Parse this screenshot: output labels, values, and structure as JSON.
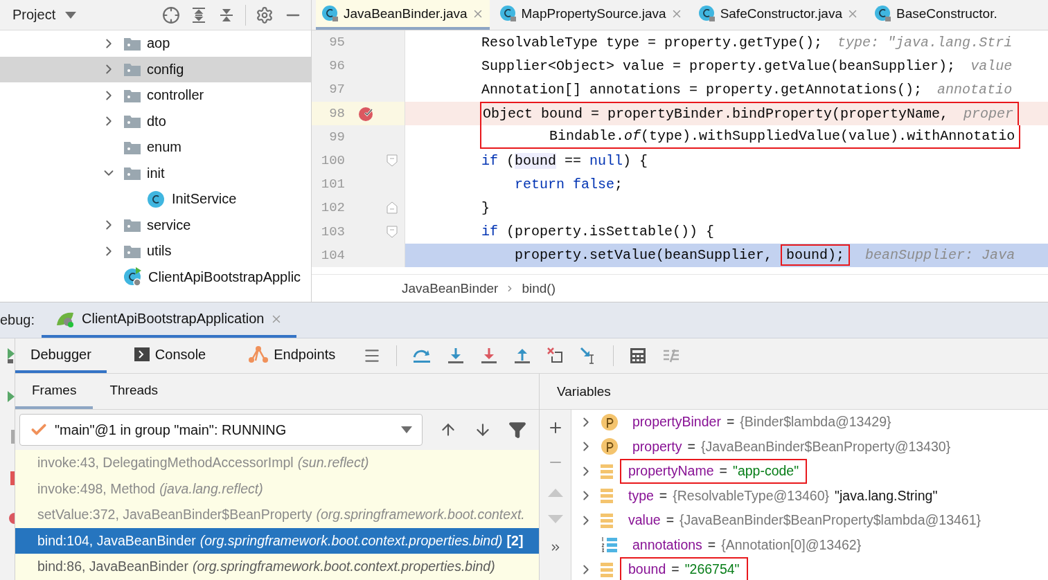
{
  "project_panel": {
    "title": "Project",
    "tree": [
      {
        "kind": "folder",
        "label": "aop",
        "expanded": false,
        "selected": false
      },
      {
        "kind": "folder",
        "label": "config",
        "expanded": false,
        "selected": true
      },
      {
        "kind": "folder",
        "label": "controller",
        "expanded": false,
        "selected": false
      },
      {
        "kind": "folder",
        "label": "dto",
        "expanded": false,
        "selected": false
      },
      {
        "kind": "leaf-folder",
        "label": "enum",
        "selected": false
      },
      {
        "kind": "folder",
        "label": "init",
        "expanded": true,
        "selected": false,
        "children": [
          {
            "kind": "class",
            "label": "InitService",
            "selected": false
          }
        ]
      },
      {
        "kind": "folder",
        "label": "service",
        "expanded": false,
        "selected": false
      },
      {
        "kind": "folder",
        "label": "utils",
        "expanded": false,
        "selected": false
      },
      {
        "kind": "app",
        "label": "ClientApiBootstrapApplic",
        "selected": false
      }
    ]
  },
  "editor": {
    "tabs": [
      {
        "label": "JavaBeanBinder.java",
        "selected": true,
        "closable": true
      },
      {
        "label": "MapPropertySource.java",
        "selected": false,
        "closable": true
      },
      {
        "label": "SafeConstructor.java",
        "selected": false,
        "closable": true
      },
      {
        "label": "BaseConstructor.",
        "selected": false,
        "closable": false
      }
    ],
    "lines": [
      {
        "number": "95",
        "breakpoint": false,
        "current": false,
        "boxed": false,
        "tokens": [
          {
            "kind": "plain",
            "text": "ResolvableType type = property.getType();"
          },
          {
            "kind": "hint",
            "text": "type: \"java.lang.Stri"
          }
        ]
      },
      {
        "number": "96",
        "breakpoint": false,
        "current": false,
        "boxed": false,
        "tokens": [
          {
            "kind": "plain",
            "text": "Supplier<Object> value = property.getValue(beanSupplier);"
          },
          {
            "kind": "hint",
            "text": "value"
          }
        ]
      },
      {
        "number": "97",
        "breakpoint": false,
        "current": false,
        "boxed": false,
        "tokens": [
          {
            "kind": "plain",
            "text": "Annotation[] annotations = property.getAnnotations();"
          },
          {
            "kind": "hint",
            "text": "annotatio"
          }
        ]
      },
      {
        "number": "98",
        "breakpoint": true,
        "current": false,
        "boxed": true,
        "tokens": [
          {
            "kind": "plain",
            "text": "Object bound = propertyBinder.bindProperty(propertyName,"
          },
          {
            "kind": "hint",
            "text": "proper"
          }
        ]
      },
      {
        "number": "99",
        "breakpoint": false,
        "current": false,
        "boxed": true,
        "tokens": [
          {
            "kind": "plain",
            "text": "        Bindable."
          },
          {
            "kind": "italic",
            "text": "of"
          },
          {
            "kind": "plain",
            "text": "(type).withSuppliedValue(value).withAnnotatio"
          }
        ]
      },
      {
        "number": "100",
        "breakpoint": false,
        "current": false,
        "boxed": false,
        "fold_open": true,
        "tokens": [
          {
            "kind": "keyword",
            "text": "if"
          },
          {
            "kind": "plain",
            "text": " ("
          },
          {
            "kind": "usage",
            "text": "bound"
          },
          {
            "kind": "plain",
            "text": " == "
          },
          {
            "kind": "keyword",
            "text": "null"
          },
          {
            "kind": "plain",
            "text": ") {"
          }
        ]
      },
      {
        "number": "101",
        "breakpoint": false,
        "current": false,
        "boxed": false,
        "tokens": [
          {
            "kind": "keyword",
            "text": "    return false"
          },
          {
            "kind": "plain",
            "text": ";"
          }
        ]
      },
      {
        "number": "102",
        "breakpoint": false,
        "current": false,
        "boxed": false,
        "fold_close": true,
        "tokens": [
          {
            "kind": "plain",
            "text": "}"
          }
        ]
      },
      {
        "number": "103",
        "breakpoint": false,
        "current": false,
        "boxed": false,
        "fold_open": true,
        "tokens": [
          {
            "kind": "keyword",
            "text": "if"
          },
          {
            "kind": "plain",
            "text": " (property.isSettable()) {"
          }
        ]
      },
      {
        "number": "104",
        "breakpoint": false,
        "current": true,
        "boxed": false,
        "tokens": [
          {
            "kind": "plain",
            "text": "    property.setValue(beanSupplier, "
          },
          {
            "kind": "boxed",
            "text": "bound);"
          },
          {
            "kind": "hint",
            "text": "beanSupplier: Java"
          }
        ]
      }
    ],
    "breadcrumb": [
      "JavaBeanBinder",
      "bind()"
    ]
  },
  "debug": {
    "label": "ebug:",
    "session_tab": {
      "label": "ClientApiBootstrapApplication",
      "selected": true
    },
    "tabs": [
      {
        "label": "Debugger",
        "selected": true
      },
      {
        "label": "Console",
        "selected": false
      },
      {
        "label": "Endpoints",
        "selected": false
      }
    ],
    "frames_panel": {
      "tabs": [
        {
          "label": "Frames",
          "selected": true
        },
        {
          "label": "Threads",
          "selected": false
        }
      ],
      "thread": "\"main\"@1 in group \"main\": RUNNING",
      "frames": [
        {
          "method": "invoke:43, DelegatingMethodAccessorImpl",
          "package": "(sun.reflect)",
          "library": true,
          "selected": false
        },
        {
          "method": "invoke:498, Method",
          "package": "(java.lang.reflect)",
          "library": true,
          "selected": false
        },
        {
          "method": "setValue:372, JavaBeanBinder$BeanProperty",
          "package": "(org.springframework.boot.context.",
          "library": true,
          "selected": false
        },
        {
          "method": "bind:104, JavaBeanBinder",
          "package": "(org.springframework.boot.context.properties.bind)",
          "badge": "[2]",
          "library": false,
          "selected": true
        },
        {
          "method": "bind:86, JavaBeanBinder",
          "package": "(org.springframework.boot.context.properties.bind)",
          "library": false,
          "selected": false
        }
      ]
    },
    "variables_panel": {
      "title": "Variables",
      "variables": [
        {
          "kind": "param",
          "name": "propertyBinder",
          "separator": "=",
          "value": "{Binder$lambda@13429}",
          "is_string": false,
          "expandable": true,
          "boxed": false
        },
        {
          "kind": "param",
          "name": "property",
          "separator": "=",
          "value": "{JavaBeanBinder$BeanProperty@13430}",
          "is_string": false,
          "expandable": true,
          "boxed": false
        },
        {
          "kind": "field",
          "name": "propertyName",
          "separator": "=",
          "value": "\"app-code\"",
          "is_string": true,
          "expandable": true,
          "boxed": true
        },
        {
          "kind": "field",
          "name": "type",
          "separator": "=",
          "value": "{ResolvableType@13460}",
          "extra": "\"java.lang.String\"",
          "is_string": false,
          "expandable": true,
          "boxed": false
        },
        {
          "kind": "field",
          "name": "value",
          "separator": "=",
          "value": "{JavaBeanBinder$BeanProperty$lambda@13461}",
          "is_string": false,
          "expandable": true,
          "boxed": false
        },
        {
          "kind": "array",
          "name": "annotations",
          "separator": "=",
          "value": "{Annotation[0]@13462}",
          "is_string": false,
          "expandable": false,
          "boxed": false
        },
        {
          "kind": "field",
          "name": "bound",
          "separator": "=",
          "value": "\"266754\"",
          "is_string": true,
          "expandable": true,
          "boxed": true
        }
      ]
    }
  }
}
